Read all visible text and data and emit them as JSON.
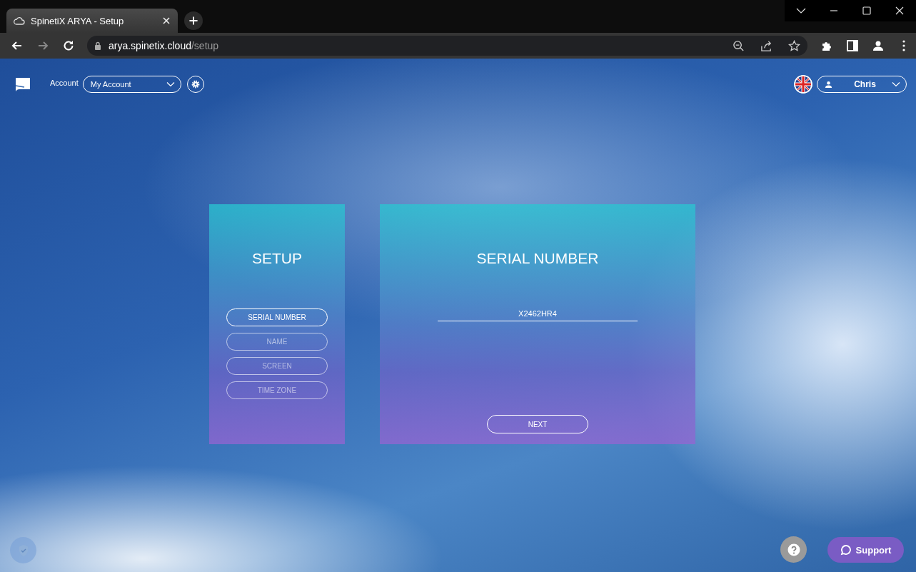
{
  "browser": {
    "tab_title": "SpinetiX ARYA - Setup",
    "url_host": "arya.spinetix.cloud",
    "url_path": "/setup"
  },
  "header": {
    "account_label": "Account",
    "account_select": "My Account",
    "user": "Chris"
  },
  "setup": {
    "title": "SETUP",
    "steps": [
      {
        "label": "SERIAL NUMBER",
        "selected": true
      },
      {
        "label": "NAME",
        "selected": false
      },
      {
        "label": "SCREEN",
        "selected": false
      },
      {
        "label": "TIME ZONE",
        "selected": false
      }
    ]
  },
  "panel": {
    "title": "SERIAL NUMBER",
    "serial_value": "X2462HR4",
    "next_button": "NEXT"
  },
  "support_button": "Support"
}
